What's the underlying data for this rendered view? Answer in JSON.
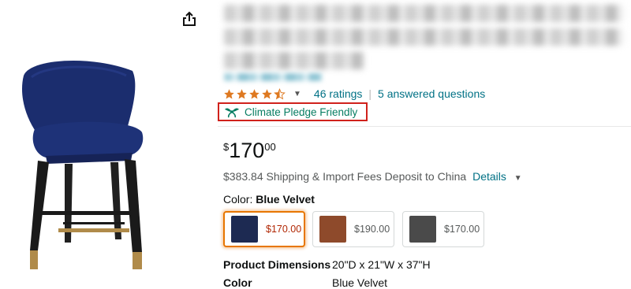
{
  "product": {
    "rating_value": 4.5,
    "ratings_label": "46 ratings",
    "separator": "|",
    "questions_label": "5 answered questions",
    "climate_badge": "Climate Pledge Friendly",
    "price_symbol": "$",
    "price_whole": "170",
    "price_fraction": "00",
    "shipping_text": "$383.84 Shipping & Import Fees Deposit to China",
    "shipping_link": "Details",
    "color_label": "Color: ",
    "color_value": "Blue Velvet",
    "swatches": [
      {
        "price": "$170.00",
        "color": "#1d2a52",
        "selected": true
      },
      {
        "price": "$190.00",
        "color": "#8e4a2b",
        "selected": false
      },
      {
        "price": "$170.00",
        "color": "#4a4a4a",
        "selected": false
      }
    ],
    "specs": [
      {
        "label": "Product Dimensions",
        "value": "20\"D x 21\"W x 37\"H"
      },
      {
        "label": "Color",
        "value": "Blue Velvet"
      }
    ]
  },
  "icons": {
    "share": "share-icon",
    "chevron": "chevron-down-icon",
    "climate": "climate-pledge-icon",
    "star": "star-icon"
  },
  "colors": {
    "link": "#007185",
    "star": "#de7921",
    "climate_green": "#067d62",
    "badge_border": "#d0211c",
    "selected_price": "#b12704",
    "selected_border": "#e77600"
  }
}
